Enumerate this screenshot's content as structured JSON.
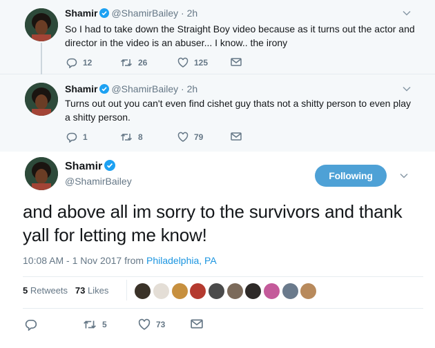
{
  "colors": {
    "accent": "#1b95e0",
    "follow_bg": "#4ea1d6",
    "muted": "#657786",
    "verified": "#1da1f2"
  },
  "thread": [
    {
      "name": "Shamir",
      "handle": "@ShamirBailey",
      "dot": "·",
      "time": "2h",
      "text": "So I had to take down the Straight  Boy video because as it turns out the actor and director in the video is an abuser... I know.. the irony",
      "replies": "12",
      "retweets": "26",
      "likes": "125"
    },
    {
      "name": "Shamir",
      "handle": "@ShamirBailey",
      "dot": "·",
      "time": "2h",
      "text": "Turns out out you can't even find cishet guy thats not a shitty person to even play a shitty person.",
      "replies": "1",
      "retweets": "8",
      "likes": "79"
    }
  ],
  "main": {
    "name": "Shamir",
    "handle": "@ShamirBailey",
    "follow_label": "Following",
    "text": "and above all im sorry to the survivors and thank yall for letting me know!",
    "timestamp": "10:08 AM - 1 Nov 2017 from ",
    "location": "Philadelphia, PA",
    "retweets_count": "5",
    "retweets_label": " Retweets",
    "likes_count": "73",
    "likes_label": " Likes",
    "actions": {
      "replies": "",
      "retweets": "5",
      "likes": "73"
    }
  },
  "icons": [
    "verified-badge-icon",
    "reply-icon",
    "retweet-icon",
    "like-heart-icon",
    "direct-message-icon",
    "chevron-down-icon"
  ]
}
